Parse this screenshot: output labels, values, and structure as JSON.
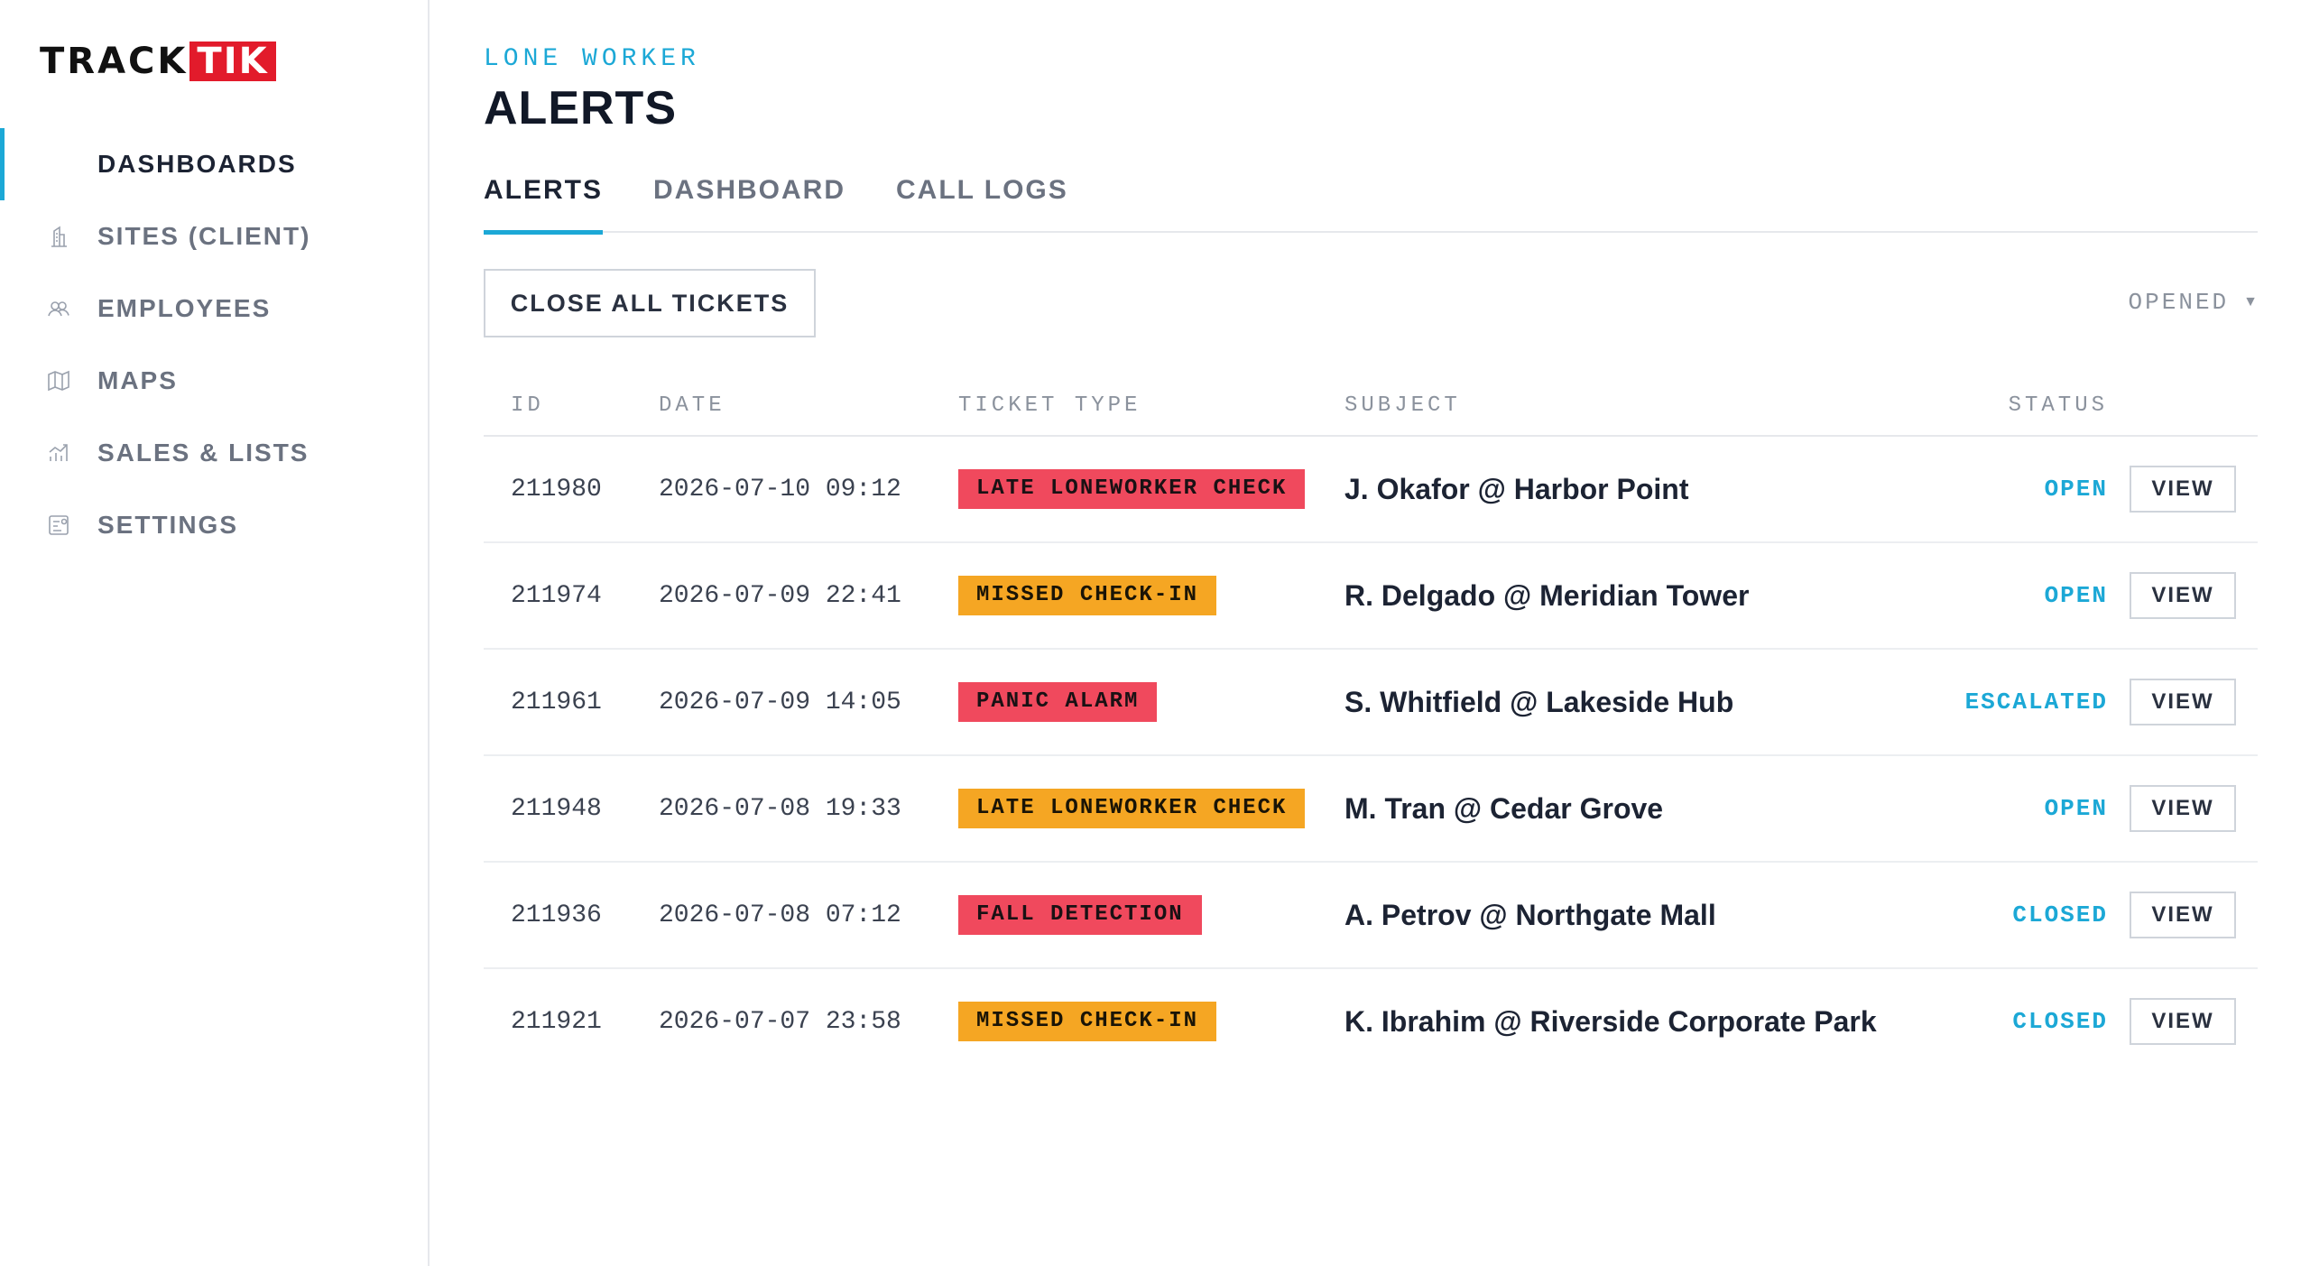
{
  "logo": {
    "track": "TRACK",
    "tik": "TIK"
  },
  "colors": {
    "accent": "#1ca8d6",
    "brand_red": "#e21b2b",
    "badge_red": "#f0495d",
    "badge_amber": "#f5a623"
  },
  "sidebar": {
    "items": [
      {
        "label": "DASHBOARDS",
        "icon": "dashboard-icon",
        "active": true
      },
      {
        "label": "SITES (CLIENT)",
        "icon": "building-icon",
        "active": false
      },
      {
        "label": "EMPLOYEES",
        "icon": "users-icon",
        "active": false
      },
      {
        "label": "MAPS",
        "icon": "map-icon",
        "active": false
      },
      {
        "label": "SALES & LISTS",
        "icon": "chart-icon",
        "active": false
      },
      {
        "label": "SETTINGS",
        "icon": "settings-icon",
        "active": false
      }
    ]
  },
  "header": {
    "eyebrow": "LONE WORKER",
    "title": "ALERTS"
  },
  "tabs": [
    {
      "label": "ALERTS",
      "active": true
    },
    {
      "label": "DASHBOARD",
      "active": false
    },
    {
      "label": "CALL LOGS",
      "active": false
    }
  ],
  "toolbar": {
    "close_all_label": "CLOSE ALL TICKETS",
    "filter_label": "OPENED"
  },
  "table": {
    "columns": {
      "id": "ID",
      "date": "DATE",
      "type": "TICKET TYPE",
      "subject": "SUBJECT",
      "status": "STATUS"
    },
    "view_label": "VIEW",
    "rows": [
      {
        "id": "211980",
        "date": "2026-07-10 09:12",
        "type": "LATE LONEWORKER CHECK",
        "type_color": "red",
        "subject": "J. Okafor @ Harbor Point",
        "status": "OPEN"
      },
      {
        "id": "211974",
        "date": "2026-07-09 22:41",
        "type": "MISSED CHECK-IN",
        "type_color": "amber",
        "subject": "R. Delgado @ Meridian Tower",
        "status": "OPEN"
      },
      {
        "id": "211961",
        "date": "2026-07-09 14:05",
        "type": "PANIC ALARM",
        "type_color": "red",
        "subject": "S. Whitfield @ Lakeside Hub",
        "status": "ESCALATED"
      },
      {
        "id": "211948",
        "date": "2026-07-08 19:33",
        "type": "LATE LONEWORKER CHECK",
        "type_color": "amber",
        "subject": "M. Tran @ Cedar Grove",
        "status": "OPEN"
      },
      {
        "id": "211936",
        "date": "2026-07-08 07:12",
        "type": "FALL DETECTION",
        "type_color": "red",
        "subject": "A. Petrov @ Northgate Mall",
        "status": "CLOSED"
      },
      {
        "id": "211921",
        "date": "2026-07-07 23:58",
        "type": "MISSED CHECK-IN",
        "type_color": "amber",
        "subject": "K. Ibrahim @ Riverside Corporate Park",
        "status": "CLOSED"
      }
    ]
  }
}
